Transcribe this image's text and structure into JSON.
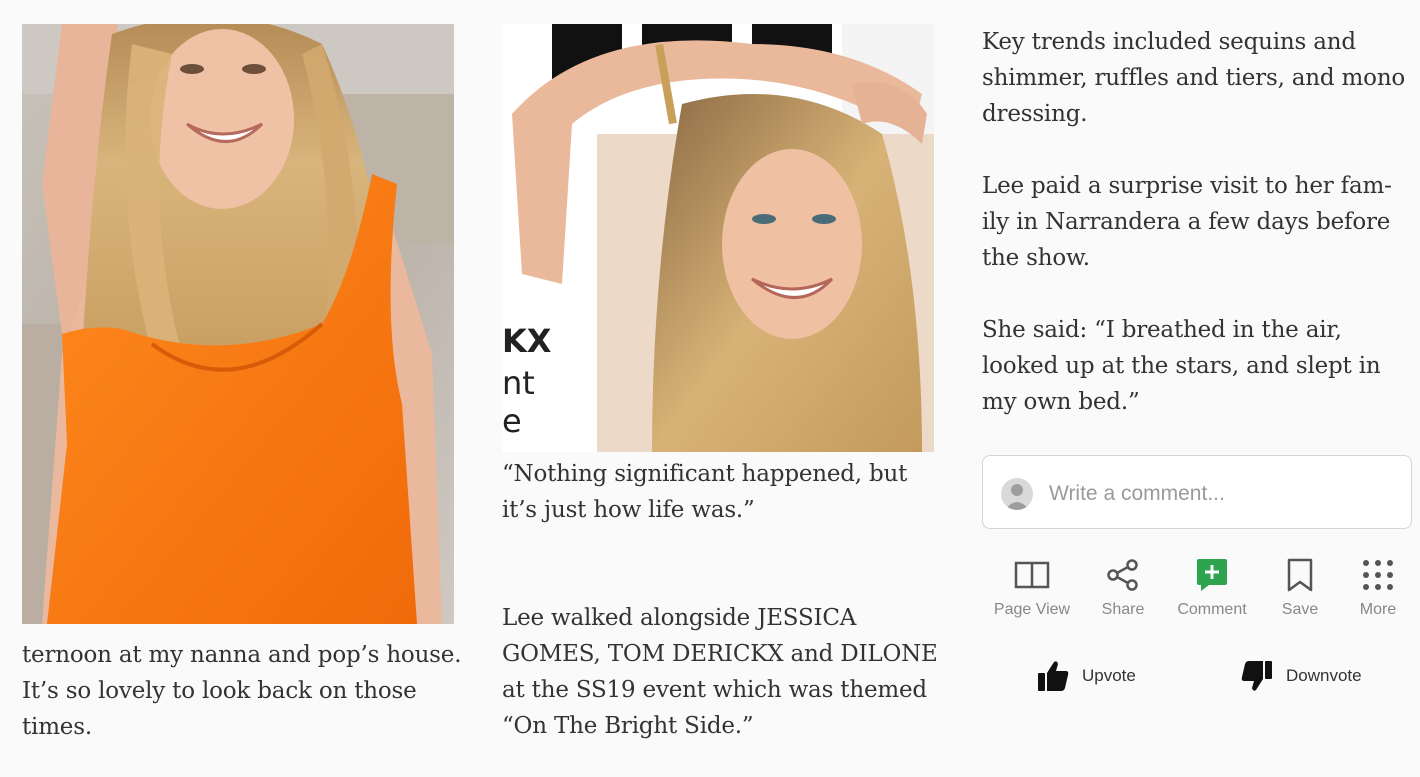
{
  "article": {
    "left_caption": "ternoon at my nanna and pop’s house. It’s so lovely to look back on those times.",
    "mid_quote": "“Nothing significant happened, but it’s just how life was.”",
    "mid_paragraph": "Lee walked alongside JESSICA GOMES, TOM DERICKX and DILONE at the SS19 event which was themed “On The Bright Side.”",
    "right_paragraph_1": "Key trends included sequins and shimmer, ruffles and tiers, and mono dressing.",
    "right_paragraph_2": "Lee paid a surprise visit to her fam-ily in Narrandera a few days before the show.",
    "right_paragraph_3": "She said: “I breathed in the air, looked up at the stars, and slept in my own bed.”",
    "magazine_fragment": [
      "KX",
      "nt",
      "e"
    ]
  },
  "comment": {
    "placeholder": "Write a comment...",
    "value": ""
  },
  "toolbar": {
    "page_view_label": "Page View",
    "share_label": "Share",
    "comment_label": "Comment",
    "save_label": "Save",
    "more_label": "More"
  },
  "votes": {
    "upvote_label": "Upvote",
    "downvote_label": "Downvote"
  },
  "icons": {
    "page_view": "book-open-icon",
    "share": "share-icon",
    "comment": "comment-add-icon",
    "save": "bookmark-icon",
    "more": "grid-dots-icon",
    "upvote": "thumbs-up-icon",
    "downvote": "thumbs-down-icon"
  },
  "colors": {
    "comment_accent": "#2ea44f",
    "icon_gray": "#555555",
    "label_gray": "#888888"
  }
}
